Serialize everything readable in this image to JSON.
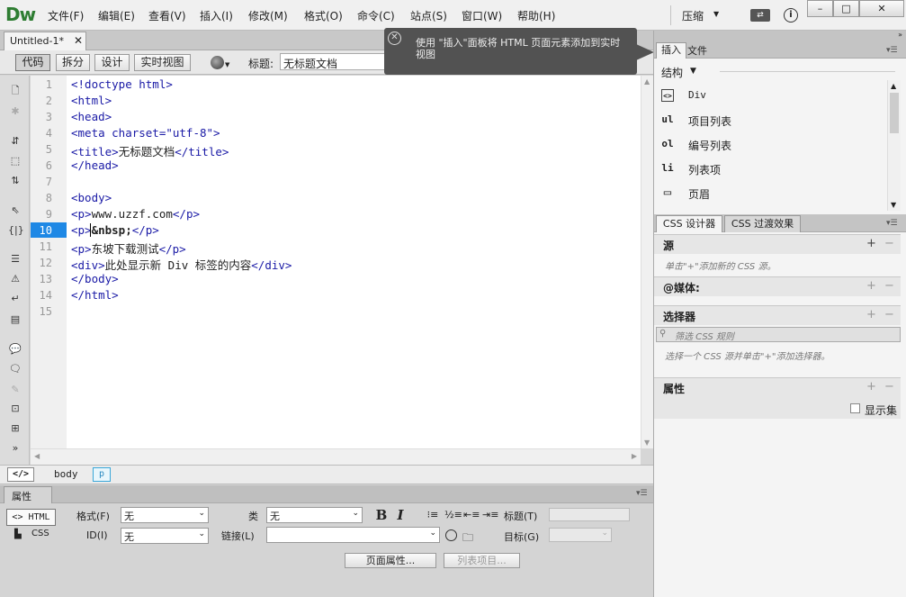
{
  "app": {
    "logo": "Dw",
    "menu": [
      "文件(F)",
      "编辑(E)",
      "查看(V)",
      "插入(I)",
      "修改(M)",
      "格式(O)",
      "命令(C)",
      "站点(S)",
      "窗口(W)",
      "帮助(H)"
    ],
    "workspace": "压缩",
    "window_controls": {
      "minimize": "–",
      "maximize": "□",
      "close": "✕"
    }
  },
  "document": {
    "tab_label": "Untitled-1*",
    "tab_close": "✕",
    "views": {
      "code": "代码",
      "split": "拆分",
      "design": "设计",
      "live": "实时视图"
    },
    "title_label": "标题:",
    "title_value": "无标题文档"
  },
  "tooltip": {
    "text": "使用 \"插入\"面板将 HTML 页面元素添加到实时视图"
  },
  "editor": {
    "active_line": 10,
    "lines": [
      {
        "n": "1",
        "code": "<!doctype html>"
      },
      {
        "n": "2",
        "code": "<html>"
      },
      {
        "n": "3",
        "code": "<head>"
      },
      {
        "n": "4",
        "code": "<meta charset=\"utf-8\">"
      },
      {
        "n": "5",
        "code": "<title>无标题文档</title>"
      },
      {
        "n": "6",
        "code": "</head>"
      },
      {
        "n": "7",
        "code": ""
      },
      {
        "n": "8",
        "code": "<body>"
      },
      {
        "n": "9",
        "code": "<p>www.uzzf.com</p>"
      },
      {
        "n": "10",
        "code": "<p>&nbsp;</p>"
      },
      {
        "n": "11",
        "code": "<p>东坡下载测试</p>"
      },
      {
        "n": "12",
        "code": "<div>此处显示新 Div 标签的内容</div>"
      },
      {
        "n": "13",
        "code": "</body>"
      },
      {
        "n": "14",
        "code": "</html>"
      },
      {
        "n": "15",
        "code": ""
      }
    ]
  },
  "tag_selector": {
    "icon": "</>",
    "body": "body",
    "p": "p"
  },
  "properties": {
    "tab": "属性",
    "html_btn": "<> HTML",
    "css_btn": "CSS",
    "format_label": "格式(F)",
    "format_value": "无",
    "class_label": "类",
    "class_value": "无",
    "id_label": "ID(I)",
    "id_value": "无",
    "link_label": "链接(L)",
    "link_value": "",
    "bold": "B",
    "italic": "I",
    "title_label": "标题(T)",
    "target_label": "目标(G)",
    "page_props_btn": "页面属性...",
    "list_item_btn": "列表项目..."
  },
  "insert_panel": {
    "tabs": [
      "插入",
      "文件"
    ],
    "category": "结构",
    "items": [
      {
        "icon": "<>",
        "label": "Div"
      },
      {
        "icon": "ul",
        "label": "项目列表"
      },
      {
        "icon": "ol",
        "label": "编号列表"
      },
      {
        "icon": "li",
        "label": "列表项"
      },
      {
        "icon": "▭",
        "label": "页眉"
      }
    ]
  },
  "css_panel": {
    "tabs": [
      "CSS 设计器",
      "CSS 过渡效果"
    ],
    "source_title": "源",
    "source_hint": "单击\"+\"添加新的 CSS 源。",
    "media_title": "@媒体:",
    "selector_title": "选择器",
    "filter_placeholder": "筛选 CSS 规则",
    "selector_hint": "选择一个 CSS 源并单击\"+\"添加选择器。",
    "properties_title": "属性",
    "show_all": "显示集"
  }
}
